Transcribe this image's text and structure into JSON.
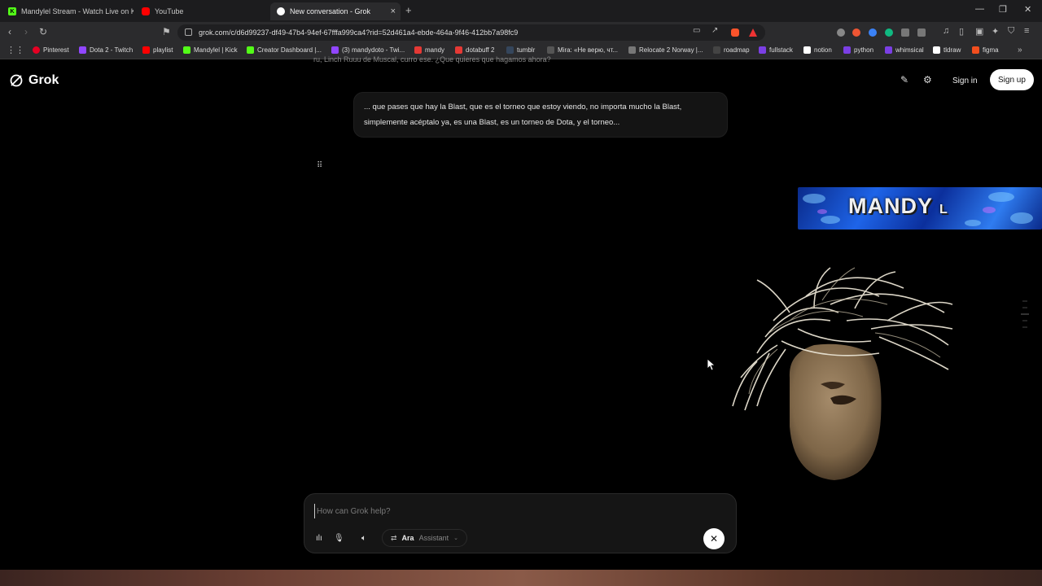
{
  "tabs": [
    {
      "title": "Mandylel Stream - Watch Live on Kick",
      "icon": "kick-icon",
      "color": "#53fc18"
    },
    {
      "title": "YouTube",
      "icon": "youtube-icon",
      "color": "#ff0000"
    },
    {
      "title": "New conversation - Grok",
      "icon": "grok-icon",
      "color": "#ffffff",
      "active": true
    }
  ],
  "address_bar": {
    "url": "grok.com/c/d6d99237-df49-47b4-94ef-67fffa999ca4?rid=52d461a4-ebde-464a-9f46-412bb7a98fc9"
  },
  "bookmarks": [
    {
      "label": "Pinterest",
      "color": "#e60023"
    },
    {
      "label": "Dota 2 - Twitch",
      "color": "#9146ff"
    },
    {
      "label": "playlist",
      "color": "#ff0000"
    },
    {
      "label": "Mandylel | Kick",
      "color": "#53fc18"
    },
    {
      "label": "Creator Dashboard |...",
      "color": "#53fc18"
    },
    {
      "label": "(3) mandydoto - Twi...",
      "color": "#9146ff"
    },
    {
      "label": "mandy",
      "color": "#e53935"
    },
    {
      "label": "dotabuff 2",
      "color": "#e53935"
    },
    {
      "label": "tumblr",
      "color": "#35465c"
    },
    {
      "label": "Mira: «Не верю, чт...",
      "color": "#555555"
    },
    {
      "label": "Relocate 2 Norway |...",
      "color": "#777777"
    },
    {
      "label": "roadmap",
      "color": "#444444"
    },
    {
      "label": "fullstack",
      "color": "#7b3fe4"
    },
    {
      "label": "notion",
      "color": "#ffffff"
    },
    {
      "label": "python",
      "color": "#7b3fe4"
    },
    {
      "label": "whimsical",
      "color": "#7b3fe4"
    },
    {
      "label": "tldraw",
      "color": "#ffffff"
    },
    {
      "label": "figma",
      "color": "#f24e1e"
    }
  ],
  "grok": {
    "logo_text": "Grok",
    "signin": "Sign in",
    "signup": "Sign up",
    "previous_message_fragment": "ru, Linch Ruuu de Muscal, curro ese. ¿Que quieres que hagamos ahora?",
    "user_message": "... que pases que hay la Blast, que es el torneo que estoy viendo, no importa mucho la Blast, simplemente acéptalo ya, es una Blast, es un torneo de Dota, y el torneo...",
    "composer_placeholder": "How can Grok help?",
    "voice_name": "Ara",
    "voice_role": "Assistant"
  },
  "overlay": {
    "banner_main": "MANDY",
    "banner_small": "L"
  }
}
